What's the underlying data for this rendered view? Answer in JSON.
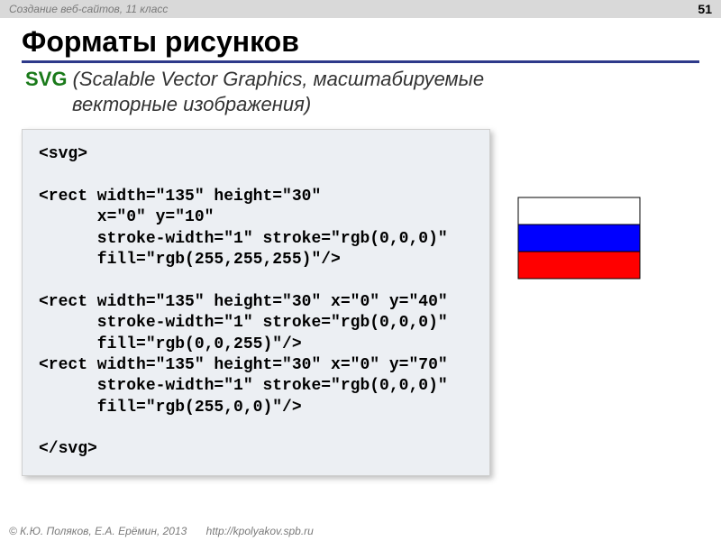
{
  "header": {
    "course": "Создание веб-сайтов, 11 класс",
    "page_number": "51"
  },
  "title": "Форматы рисунков",
  "subtitle": {
    "abbr": "SVG",
    "expansion_line1": "(Scalable Vector Graphics, масштабируемые",
    "expansion_line2": "векторные изображения)"
  },
  "code": "<svg>\n\n<rect width=\"135\" height=\"30\"\n      x=\"0\" y=\"10\"\n      stroke-width=\"1\" stroke=\"rgb(0,0,0)\"\n      fill=\"rgb(255,255,255)\"/>\n\n<rect width=\"135\" height=\"30\" x=\"0\" y=\"40\"\n      stroke-width=\"1\" stroke=\"rgb(0,0,0)\"\n      fill=\"rgb(0,0,255)\"/>\n<rect width=\"135\" height=\"30\" x=\"0\" y=\"70\"\n      stroke-width=\"1\" stroke=\"rgb(0,0,0)\"\n      fill=\"rgb(255,0,0)\"/>\n\n</svg>",
  "flag": {
    "stripes": [
      {
        "y": 10,
        "fill": "rgb(255,255,255)"
      },
      {
        "y": 40,
        "fill": "rgb(0,0,255)"
      },
      {
        "y": 70,
        "fill": "rgb(255,0,0)"
      }
    ],
    "width": 135,
    "height": 30
  },
  "footer": {
    "copyright": "© К.Ю. Поляков, Е.А. Ерёмин, 2013",
    "link": "http://kpolyakov.spb.ru"
  }
}
